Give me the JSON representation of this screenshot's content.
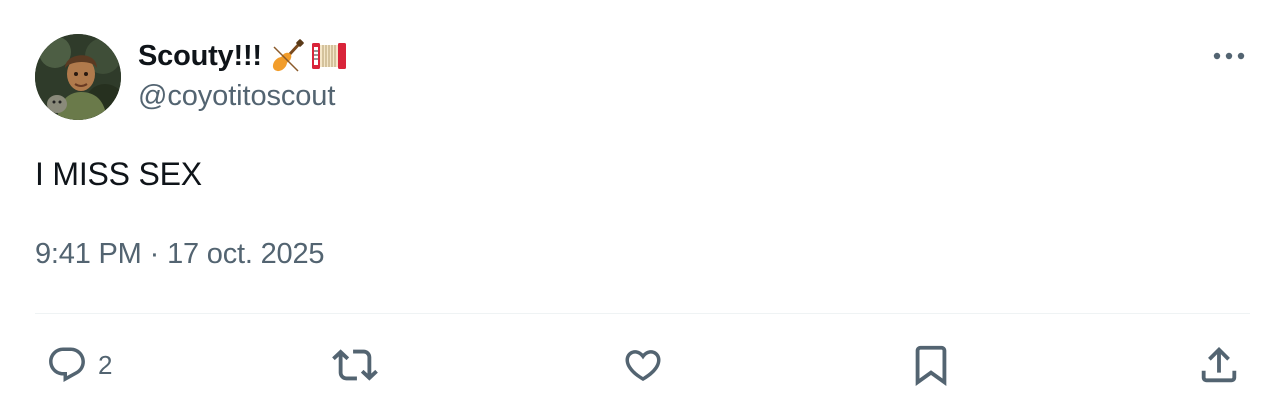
{
  "post": {
    "author": {
      "display_name": "Scouty!!!",
      "emojis": [
        "violin-emoji",
        "accordion-emoji"
      ],
      "handle": "@coyotitoscout"
    },
    "text": "I MISS SEX",
    "time": "9:41 PM",
    "separator": "·",
    "date": "17 oct. 2025"
  },
  "actions": {
    "reply_count": "2",
    "repost_count": "",
    "like_count": ""
  },
  "icons": {
    "more": "more-horizontal-icon",
    "reply": "reply-icon",
    "repost": "repost-icon",
    "like": "heart-icon",
    "bookmark": "bookmark-icon",
    "share": "share-icon"
  },
  "colors": {
    "primary_text": "#0f1419",
    "secondary_text": "#536471",
    "divider": "#eff3f4"
  }
}
